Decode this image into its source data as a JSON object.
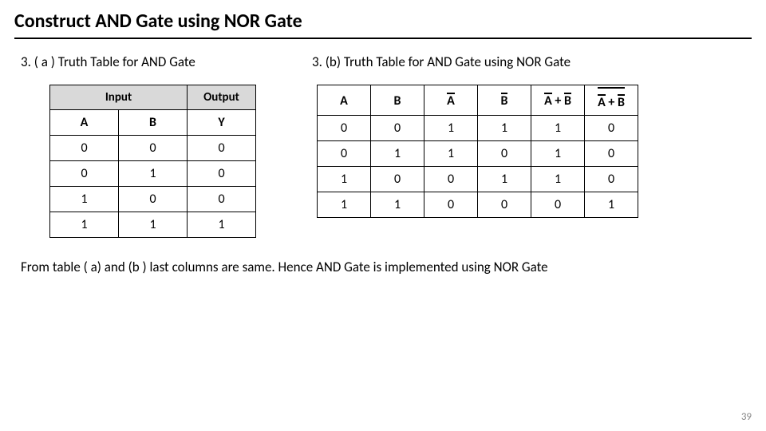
{
  "title": "Construct AND Gate using NOR Gate",
  "left": {
    "heading": "3.   ( a ) Truth Table for AND Gate",
    "group_input": "Input",
    "group_output": "Output",
    "col_a": "A",
    "col_b": "B",
    "col_y": "Y"
  },
  "right": {
    "heading": "3.   (b) Truth Table for AND Gate using NOR Gate",
    "col_a": "A",
    "col_b": "B",
    "col_abar": "A",
    "col_bbar": "B",
    "col_ab_sum": "A + B",
    "col_ab_final": "A + B"
  },
  "chart_data": [
    {
      "type": "table",
      "title": "Truth Table for AND Gate",
      "columns": [
        "A",
        "B",
        "Y"
      ],
      "rows": [
        [
          0,
          0,
          0
        ],
        [
          0,
          1,
          0
        ],
        [
          1,
          0,
          0
        ],
        [
          1,
          1,
          1
        ]
      ]
    },
    {
      "type": "table",
      "title": "Truth Table for AND Gate using NOR Gate",
      "columns": [
        "A",
        "B",
        "NOT A",
        "NOT B",
        "(NOT A)+(NOT B)",
        "NOT((NOT A)+(NOT B))"
      ],
      "rows": [
        [
          0,
          0,
          1,
          1,
          1,
          0
        ],
        [
          0,
          1,
          1,
          0,
          1,
          0
        ],
        [
          1,
          0,
          0,
          1,
          1,
          0
        ],
        [
          1,
          1,
          0,
          0,
          0,
          1
        ]
      ]
    }
  ],
  "conclusion": "From table ( a) and (b ) last columns are same. Hence AND Gate is implemented using NOR Gate",
  "page_number": "39"
}
